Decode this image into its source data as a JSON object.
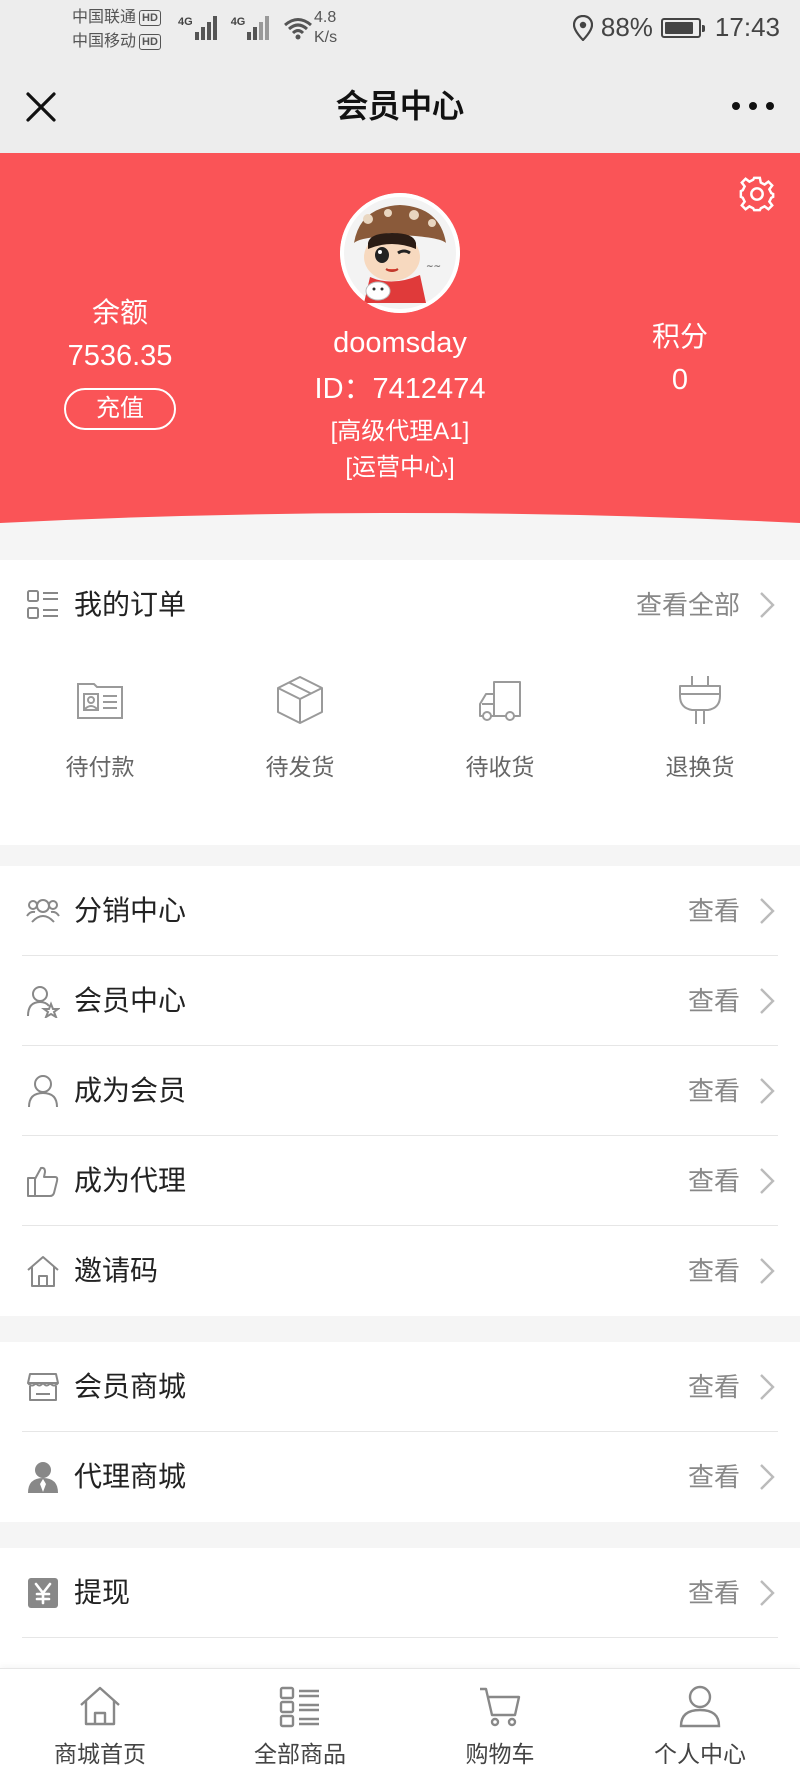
{
  "status_bar": {
    "carrier_1": "中国联通",
    "carrier_2": "中国移动",
    "hd": "HD",
    "net_label": "4G",
    "net_speed_value": "4.8",
    "net_speed_unit": "K/s",
    "battery": "88%",
    "battery_level": 0.88,
    "time": "17:43",
    "icons": [
      "signal-icon",
      "wifi-icon",
      "location-icon",
      "battery-icon"
    ]
  },
  "nav": {
    "title": "会员中心",
    "close_icon": "close-icon",
    "more_icon": "more-icon"
  },
  "colors": {
    "brand_red": "#fa5457",
    "icon_gray": "#888888",
    "text_dark": "#222222"
  },
  "header": {
    "balance_label": "余额",
    "balance_value": "7536.35",
    "recharge_label": "充值",
    "username": "doomsday",
    "user_id": "ID：7412474",
    "tag_1": "[高级代理A1]",
    "tag_2": "[运营中心]",
    "points_label": "积分",
    "points_value": "0",
    "settings_icon": "gear-icon"
  },
  "orders": {
    "title": "我的订单",
    "view_all": "查看全部",
    "statuses": [
      {
        "label": "待付款",
        "icon": "id-card-icon"
      },
      {
        "label": "待发货",
        "icon": "box-icon"
      },
      {
        "label": "待收货",
        "icon": "truck-icon"
      },
      {
        "label": "退换货",
        "icon": "plug-icon"
      }
    ]
  },
  "menu_groups": [
    [
      {
        "label": "分销中心",
        "link": "查看",
        "icon": "group-icon"
      },
      {
        "label": "会员中心",
        "link": "查看",
        "icon": "member-star-icon"
      },
      {
        "label": "成为会员",
        "link": "查看",
        "icon": "user-icon"
      },
      {
        "label": "成为代理",
        "link": "查看",
        "icon": "thumbs-up-icon"
      },
      {
        "label": "邀请码",
        "link": "查看",
        "icon": "home-icon"
      }
    ],
    [
      {
        "label": "会员商城",
        "link": "查看",
        "icon": "store-icon"
      },
      {
        "label": "代理商城",
        "link": "查看",
        "icon": "agent-icon"
      }
    ],
    [
      {
        "label": "提现",
        "link": "查看",
        "icon": "yen-icon"
      }
    ]
  ],
  "tab_bar": [
    {
      "label": "商城首页",
      "icon": "home-icon"
    },
    {
      "label": "全部商品",
      "icon": "grid-list-icon"
    },
    {
      "label": "购物车",
      "icon": "cart-icon"
    },
    {
      "label": "个人中心",
      "icon": "user-icon"
    }
  ]
}
